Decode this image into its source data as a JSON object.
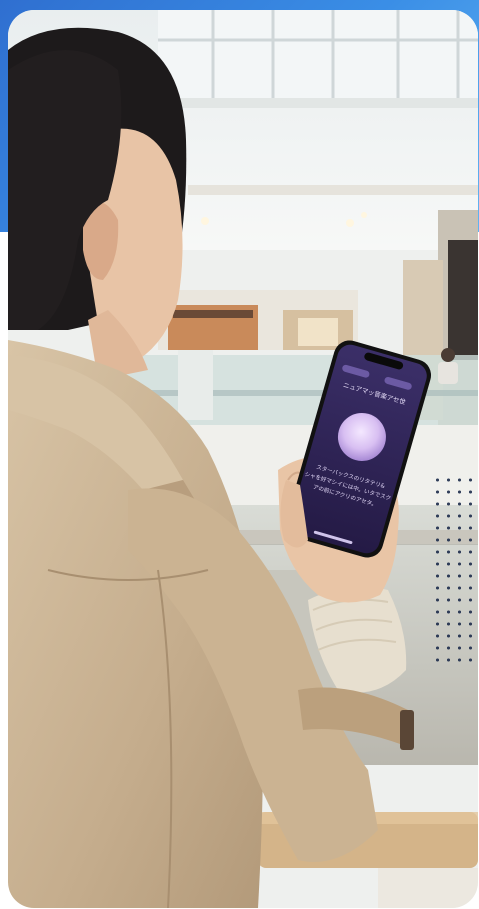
{
  "scene": {
    "description_free": true,
    "colors": {
      "accent_band": "#2f6fd0",
      "coat": "#c9b396",
      "phone_screen": "#3a2d63",
      "orb": "#d9c2f2",
      "dots": "#1b2a4a"
    }
  },
  "phone": {
    "header_title": "ニュアマッ音楽アセ世",
    "pill_left": "",
    "pill_right": "",
    "body_lines": [
      "スターバックスのリタテリ&",
      "シャを好マシイには中。いタでスク",
      "アの前にアクリのアセタ。"
    ]
  }
}
